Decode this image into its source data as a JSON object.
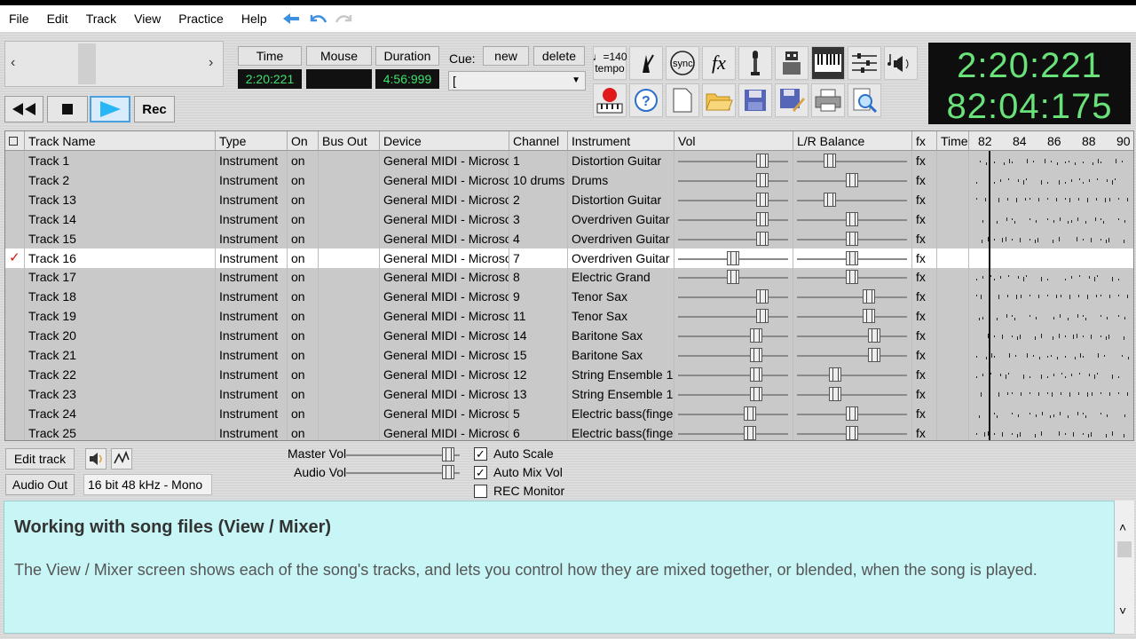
{
  "menu": [
    "File",
    "Edit",
    "Track",
    "View",
    "Practice",
    "Help"
  ],
  "time_controls": {
    "time_label": "Time",
    "mouse_label": "Mouse",
    "duration_label": "Duration",
    "time_value": "2:20:221",
    "mouse_value": "",
    "duration_value": "4:56:999",
    "cue_label": "Cue:",
    "cue_new": "new",
    "cue_delete": "delete",
    "cue_value": "["
  },
  "transport": {
    "rec": "Rec"
  },
  "tools": {
    "tempo_value": "♩=140",
    "tempo_label": "tempo",
    "fx_label": "fx"
  },
  "clock": {
    "time": "2:20:221",
    "measure": "82:04:175"
  },
  "columns": [
    "Track Name",
    "Type",
    "On",
    "Bus Out",
    "Device",
    "Channel",
    "Instrument",
    "Vol",
    "L/R Balance",
    "fx",
    "Time"
  ],
  "timeline_ticks": [
    "82",
    "84",
    "86",
    "88",
    "90"
  ],
  "tracks": [
    {
      "name": "Track 1",
      "type": "Instrument",
      "on": "on",
      "bus": "",
      "device": "General MIDI - Microso",
      "channel": "1",
      "instrument": "Distortion Guitar",
      "vol": 0.8,
      "bal": 0.27,
      "fx": "fx",
      "selected": false
    },
    {
      "name": "Track 2",
      "type": "Instrument",
      "on": "on",
      "bus": "",
      "device": "General MIDI - Microso",
      "channel": "10 drums",
      "instrument": "Drums",
      "vol": 0.8,
      "bal": 0.5,
      "fx": "fx",
      "selected": false
    },
    {
      "name": "Track 13",
      "type": "Instrument",
      "on": "on",
      "bus": "",
      "device": "General MIDI - Microso",
      "channel": "2",
      "instrument": "Distortion Guitar",
      "vol": 0.8,
      "bal": 0.27,
      "fx": "fx",
      "selected": false
    },
    {
      "name": "Track 14",
      "type": "Instrument",
      "on": "on",
      "bus": "",
      "device": "General MIDI - Microso",
      "channel": "3",
      "instrument": "Overdriven Guitar",
      "vol": 0.8,
      "bal": 0.5,
      "fx": "fx",
      "selected": false
    },
    {
      "name": "Track 15",
      "type": "Instrument",
      "on": "on",
      "bus": "",
      "device": "General MIDI - Microso",
      "channel": "4",
      "instrument": "Overdriven Guitar",
      "vol": 0.8,
      "bal": 0.5,
      "fx": "fx",
      "selected": false
    },
    {
      "name": "Track 16",
      "type": "Instrument",
      "on": "on",
      "bus": "",
      "device": "General MIDI - Microso",
      "channel": "7",
      "instrument": "Overdriven Guitar",
      "vol": 0.5,
      "bal": 0.5,
      "fx": "fx",
      "selected": true
    },
    {
      "name": "Track 17",
      "type": "Instrument",
      "on": "on",
      "bus": "",
      "device": "General MIDI - Microso",
      "channel": "8",
      "instrument": "Electric Grand",
      "vol": 0.5,
      "bal": 0.5,
      "fx": "fx",
      "selected": false
    },
    {
      "name": "Track 18",
      "type": "Instrument",
      "on": "on",
      "bus": "",
      "device": "General MIDI - Microso",
      "channel": "9",
      "instrument": "Tenor Sax",
      "vol": 0.8,
      "bal": 0.67,
      "fx": "fx",
      "selected": false
    },
    {
      "name": "Track 19",
      "type": "Instrument",
      "on": "on",
      "bus": "",
      "device": "General MIDI - Microso",
      "channel": "11",
      "instrument": "Tenor Sax",
      "vol": 0.8,
      "bal": 0.67,
      "fx": "fx",
      "selected": false
    },
    {
      "name": "Track 20",
      "type": "Instrument",
      "on": "on",
      "bus": "",
      "device": "General MIDI - Microso",
      "channel": "14",
      "instrument": "Baritone Sax",
      "vol": 0.74,
      "bal": 0.73,
      "fx": "fx",
      "selected": false
    },
    {
      "name": "Track 21",
      "type": "Instrument",
      "on": "on",
      "bus": "",
      "device": "General MIDI - Microso",
      "channel": "15",
      "instrument": "Baritone Sax",
      "vol": 0.74,
      "bal": 0.73,
      "fx": "fx",
      "selected": false
    },
    {
      "name": "Track 22",
      "type": "Instrument",
      "on": "on",
      "bus": "",
      "device": "General MIDI - Microso",
      "channel": "12",
      "instrument": "String Ensemble 1",
      "vol": 0.74,
      "bal": 0.33,
      "fx": "fx",
      "selected": false
    },
    {
      "name": "Track 23",
      "type": "Instrument",
      "on": "on",
      "bus": "",
      "device": "General MIDI - Microso",
      "channel": "13",
      "instrument": "String Ensemble 1",
      "vol": 0.74,
      "bal": 0.33,
      "fx": "fx",
      "selected": false
    },
    {
      "name": "Track 24",
      "type": "Instrument",
      "on": "on",
      "bus": "",
      "device": "General MIDI - Microso",
      "channel": "5",
      "instrument": "Electric bass(finge",
      "vol": 0.67,
      "bal": 0.5,
      "fx": "fx",
      "selected": false
    },
    {
      "name": "Track 25",
      "type": "Instrument",
      "on": "on",
      "bus": "",
      "device": "General MIDI - Microso",
      "channel": "6",
      "instrument": "Electric bass(finge",
      "vol": 0.67,
      "bal": 0.5,
      "fx": "fx",
      "selected": false
    }
  ],
  "bottom": {
    "edit_track": "Edit track",
    "audio_out": "Audio Out",
    "audio_format": "16 bit 48 kHz - Mono",
    "master_vol_label": "Master Vol",
    "audio_vol_label": "Audio Vol",
    "auto_scale": "Auto Scale",
    "auto_mix_vol": "Auto Mix Vol",
    "rec_monitor": "REC Monitor",
    "master_vol": 0.95,
    "audio_vol": 0.95
  },
  "help": {
    "title": "Working with song files (View / Mixer)",
    "body": "The View / Mixer screen shows each of the song's tracks, and lets you control how they are mixed together, or blended, when the song is played."
  },
  "colors": {
    "lcd_green": "#3fe06d",
    "help_bg": "#c8f5f5",
    "selected_row": "#ffffff",
    "check_red": "#d11"
  }
}
